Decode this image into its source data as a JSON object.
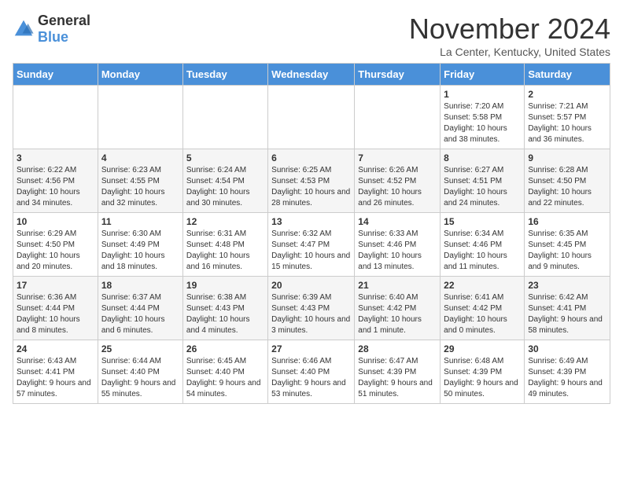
{
  "logo": {
    "general": "General",
    "blue": "Blue"
  },
  "title": "November 2024",
  "subtitle": "La Center, Kentucky, United States",
  "days": [
    "Sunday",
    "Monday",
    "Tuesday",
    "Wednesday",
    "Thursday",
    "Friday",
    "Saturday"
  ],
  "weeks": [
    [
      {
        "date": "",
        "info": ""
      },
      {
        "date": "",
        "info": ""
      },
      {
        "date": "",
        "info": ""
      },
      {
        "date": "",
        "info": ""
      },
      {
        "date": "",
        "info": ""
      },
      {
        "date": "1",
        "info": "Sunrise: 7:20 AM\nSunset: 5:58 PM\nDaylight: 10 hours and 38 minutes."
      },
      {
        "date": "2",
        "info": "Sunrise: 7:21 AM\nSunset: 5:57 PM\nDaylight: 10 hours and 36 minutes."
      }
    ],
    [
      {
        "date": "3",
        "info": "Sunrise: 6:22 AM\nSunset: 4:56 PM\nDaylight: 10 hours and 34 minutes."
      },
      {
        "date": "4",
        "info": "Sunrise: 6:23 AM\nSunset: 4:55 PM\nDaylight: 10 hours and 32 minutes."
      },
      {
        "date": "5",
        "info": "Sunrise: 6:24 AM\nSunset: 4:54 PM\nDaylight: 10 hours and 30 minutes."
      },
      {
        "date": "6",
        "info": "Sunrise: 6:25 AM\nSunset: 4:53 PM\nDaylight: 10 hours and 28 minutes."
      },
      {
        "date": "7",
        "info": "Sunrise: 6:26 AM\nSunset: 4:52 PM\nDaylight: 10 hours and 26 minutes."
      },
      {
        "date": "8",
        "info": "Sunrise: 6:27 AM\nSunset: 4:51 PM\nDaylight: 10 hours and 24 minutes."
      },
      {
        "date": "9",
        "info": "Sunrise: 6:28 AM\nSunset: 4:50 PM\nDaylight: 10 hours and 22 minutes."
      }
    ],
    [
      {
        "date": "10",
        "info": "Sunrise: 6:29 AM\nSunset: 4:50 PM\nDaylight: 10 hours and 20 minutes."
      },
      {
        "date": "11",
        "info": "Sunrise: 6:30 AM\nSunset: 4:49 PM\nDaylight: 10 hours and 18 minutes."
      },
      {
        "date": "12",
        "info": "Sunrise: 6:31 AM\nSunset: 4:48 PM\nDaylight: 10 hours and 16 minutes."
      },
      {
        "date": "13",
        "info": "Sunrise: 6:32 AM\nSunset: 4:47 PM\nDaylight: 10 hours and 15 minutes."
      },
      {
        "date": "14",
        "info": "Sunrise: 6:33 AM\nSunset: 4:46 PM\nDaylight: 10 hours and 13 minutes."
      },
      {
        "date": "15",
        "info": "Sunrise: 6:34 AM\nSunset: 4:46 PM\nDaylight: 10 hours and 11 minutes."
      },
      {
        "date": "16",
        "info": "Sunrise: 6:35 AM\nSunset: 4:45 PM\nDaylight: 10 hours and 9 minutes."
      }
    ],
    [
      {
        "date": "17",
        "info": "Sunrise: 6:36 AM\nSunset: 4:44 PM\nDaylight: 10 hours and 8 minutes."
      },
      {
        "date": "18",
        "info": "Sunrise: 6:37 AM\nSunset: 4:44 PM\nDaylight: 10 hours and 6 minutes."
      },
      {
        "date": "19",
        "info": "Sunrise: 6:38 AM\nSunset: 4:43 PM\nDaylight: 10 hours and 4 minutes."
      },
      {
        "date": "20",
        "info": "Sunrise: 6:39 AM\nSunset: 4:43 PM\nDaylight: 10 hours and 3 minutes."
      },
      {
        "date": "21",
        "info": "Sunrise: 6:40 AM\nSunset: 4:42 PM\nDaylight: 10 hours and 1 minute."
      },
      {
        "date": "22",
        "info": "Sunrise: 6:41 AM\nSunset: 4:42 PM\nDaylight: 10 hours and 0 minutes."
      },
      {
        "date": "23",
        "info": "Sunrise: 6:42 AM\nSunset: 4:41 PM\nDaylight: 9 hours and 58 minutes."
      }
    ],
    [
      {
        "date": "24",
        "info": "Sunrise: 6:43 AM\nSunset: 4:41 PM\nDaylight: 9 hours and 57 minutes."
      },
      {
        "date": "25",
        "info": "Sunrise: 6:44 AM\nSunset: 4:40 PM\nDaylight: 9 hours and 55 minutes."
      },
      {
        "date": "26",
        "info": "Sunrise: 6:45 AM\nSunset: 4:40 PM\nDaylight: 9 hours and 54 minutes."
      },
      {
        "date": "27",
        "info": "Sunrise: 6:46 AM\nSunset: 4:40 PM\nDaylight: 9 hours and 53 minutes."
      },
      {
        "date": "28",
        "info": "Sunrise: 6:47 AM\nSunset: 4:39 PM\nDaylight: 9 hours and 51 minutes."
      },
      {
        "date": "29",
        "info": "Sunrise: 6:48 AM\nSunset: 4:39 PM\nDaylight: 9 hours and 50 minutes."
      },
      {
        "date": "30",
        "info": "Sunrise: 6:49 AM\nSunset: 4:39 PM\nDaylight: 9 hours and 49 minutes."
      }
    ]
  ]
}
